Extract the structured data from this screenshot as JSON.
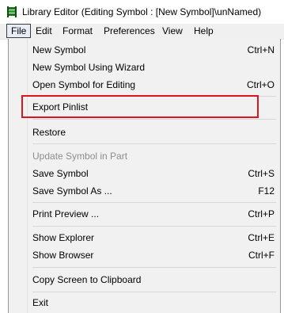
{
  "window": {
    "title": "Library Editor (Editing Symbol : [New Symbol]\\unNamed)",
    "app_icon": "library-editor-app-icon"
  },
  "menubar": {
    "items": [
      {
        "label": "File",
        "active": true
      },
      {
        "label": "Edit"
      },
      {
        "label": "Format"
      },
      {
        "label": "Preferences"
      },
      {
        "label": "View"
      },
      {
        "label": "Help"
      }
    ]
  },
  "file_menu": {
    "new_symbol": {
      "label": "New Symbol",
      "shortcut": "Ctrl+N"
    },
    "new_symbol_wizard": {
      "label": "New Symbol Using Wizard",
      "shortcut": ""
    },
    "open_symbol": {
      "label": "Open Symbol for Editing",
      "shortcut": "Ctrl+O"
    },
    "export_pinlist": {
      "label": "Export Pinlist",
      "shortcut": ""
    },
    "restore": {
      "label": "Restore",
      "shortcut": ""
    },
    "update_symbol": {
      "label": "Update Symbol in Part",
      "shortcut": "",
      "disabled": true
    },
    "save_symbol": {
      "label": "Save Symbol",
      "shortcut": "Ctrl+S"
    },
    "save_symbol_as": {
      "label": "Save Symbol As ...",
      "shortcut": "F12"
    },
    "print_preview": {
      "label": "Print Preview ...",
      "shortcut": "Ctrl+P"
    },
    "show_explorer": {
      "label": "Show Explorer",
      "shortcut": "Ctrl+E"
    },
    "show_browser": {
      "label": "Show Browser",
      "shortcut": "Ctrl+F"
    },
    "copy_screen": {
      "label": "Copy Screen to Clipboard",
      "shortcut": ""
    },
    "exit": {
      "label": "Exit",
      "shortcut": ""
    }
  },
  "colors": {
    "highlight_box": "#e0141e",
    "menu_background": "#f1f1f1",
    "disabled_text": "#8d8d8d"
  }
}
